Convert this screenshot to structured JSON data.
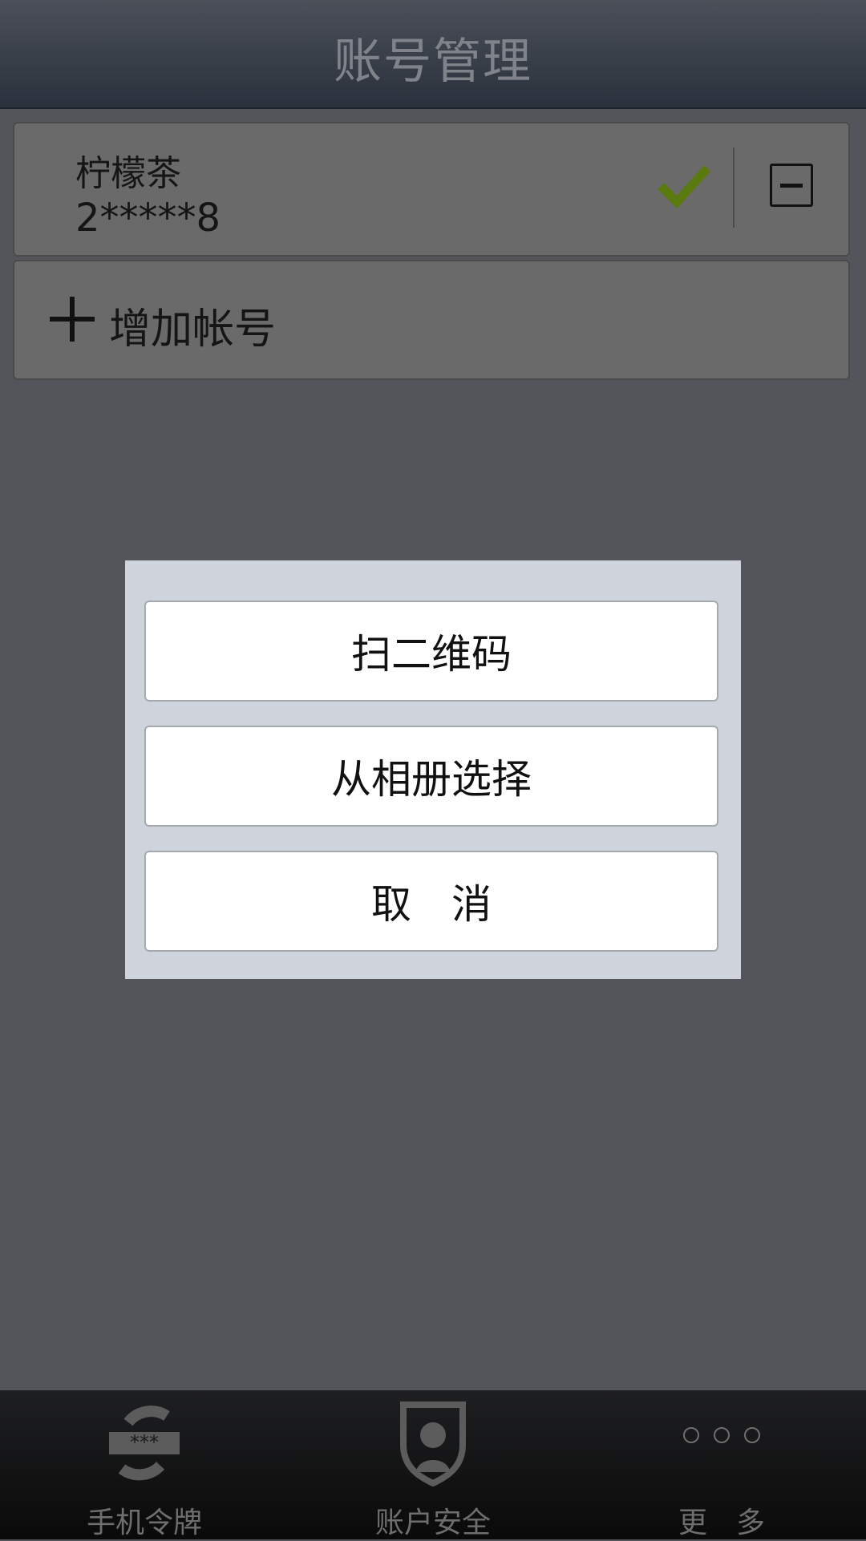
{
  "header": {
    "title": "账号管理"
  },
  "accounts": [
    {
      "name": "柠檬茶",
      "number": "2*****8"
    }
  ],
  "add_account_label": "增加帐号",
  "dialog": {
    "scan_label": "扫二维码",
    "album_label": "从相册选择",
    "cancel_label": "取　消"
  },
  "tabbar": {
    "items": [
      {
        "label": "手机令牌",
        "icon": "token-icon"
      },
      {
        "label": "账户安全",
        "icon": "shield-user-icon"
      },
      {
        "label": "更　多",
        "icon": "more-dots-icon"
      }
    ]
  },
  "colors": {
    "check": "#5a7a10",
    "dialog_bg": "#cfd4dc",
    "header_text": "#80848a"
  }
}
